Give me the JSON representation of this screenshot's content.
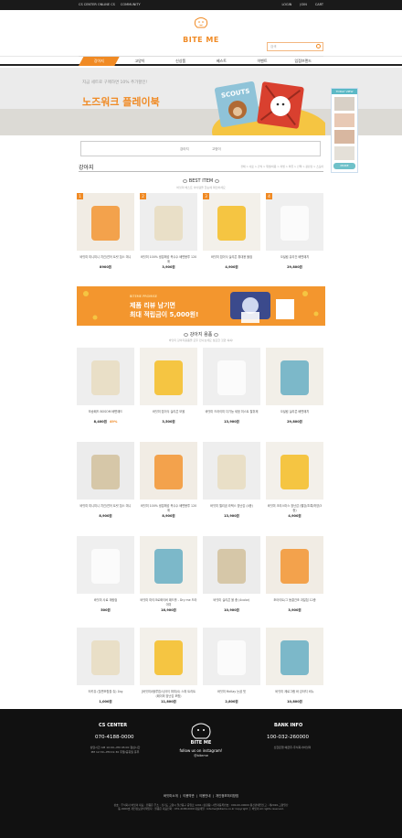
{
  "topbar": {
    "left": [
      "CS CENTER ONLINE CS",
      "COMMUNITY"
    ],
    "right": [
      "LOGIN",
      "JOIN",
      "CART"
    ]
  },
  "logo": {
    "text": "BITE ME"
  },
  "search": {
    "placeholder": "검색"
  },
  "nav": [
    "강아지",
    "고양이",
    "신상품",
    "베스트",
    "이벤트",
    "입점브랜드"
  ],
  "banner": {
    "small": "지금 세트로 구매하면 10% 추가할인!",
    "title": "노즈워크 플레이북",
    "art_labels": [
      "SCOUTS"
    ]
  },
  "sidebar": {
    "header": "TODAY VIEW",
    "footer": "MORE"
  },
  "category": {
    "items": [
      "강아지",
      "고양이"
    ]
  },
  "page": {
    "title": "강아지",
    "breadcrumb": "전체 > 사료 > 간식 > 위생/미용 > 리빙 > 의류 > 산책 > 장난감 > 스토어"
  },
  "best": {
    "title": "BEST ITEM",
    "subtitle": "바잇미 베스트 아이템을 한눈에 확인하세요",
    "items": [
      {
        "rank": "1",
        "name": "바잇미 미니미니 치킨/연어 트릿 칩스 미니",
        "price": "8900원"
      },
      {
        "rank": "2",
        "name": "바잇미 100% 생분해성 옥수수 배변봉투 120매",
        "price": "3,900원"
      },
      {
        "rank": "3",
        "name": "바잇미 접이식 실리콘 휴대용 물컵",
        "price": "4,900원"
      },
      {
        "rank": "4",
        "name": "오설림 유리건 배변패치",
        "price": "29,800원"
      }
    ]
  },
  "promo": {
    "tag": "BITEME PROMISE",
    "line1": "제품 리뷰 남기면",
    "line2": "최대 적립금이 5,000원!"
  },
  "dog": {
    "title": "강아지 용품",
    "subtitle": "바잇미 강아지용품을 모두 만나보세요 필요한 것만 쏙쏙!",
    "rows": [
      [
        {
          "name": "보송패드 BOSOM 배변패드",
          "price": "8,400원",
          "sale": "49%"
        },
        {
          "name": "바잇미 접이식 실리콘 보울",
          "price": "3,500원"
        },
        {
          "name": "바잇미 드라이미 다기능 세정 미스트 탈취제",
          "price": "13,900원"
        },
        {
          "name": "오설림 실리콘 배변패치",
          "price": "29,800원"
        }
      ],
      [
        {
          "name": "바잇미 미니미니 치킨/연어 트릿 칩스 미니",
          "price": "8,900원"
        },
        {
          "name": "바잇미 100% 생분해성 옥수수 배변봉투 120매",
          "price": "8,900원"
        },
        {
          "name": "바잇미 젤리곰 라텍스 장난감 (4종)",
          "price": "13,900원"
        },
        {
          "name": "바잇미 크리스마스 장난감 (빨강/초록/하양/3종)",
          "price": "4,900원"
        }
      ],
      [
        {
          "name": "바잇미 사료 계량컵",
          "price": "500원"
        },
        {
          "name": "바잇미 마이크로화이버 패드롤 - Dry me 드라이미",
          "price": "16,900원"
        },
        {
          "name": "바잇미 실리콘 볼 중 (4color)",
          "price": "10,900원"
        },
        {
          "name": "조아이트/그 동결건조 과일칩 12종",
          "price": "3,900원"
        }
      ],
      [
        {
          "name": "터키츄 (칠면조힘줄 츄) 1kg",
          "price": "1,000원"
        },
        {
          "name": "[바잇미X블루칩스]아이 퍼피(S) 스파 트리트 (페이퍼 장난감 포함)",
          "price": "11,800원"
        },
        {
          "name": "바잇미 McKay 눈곱 빗",
          "price": "2,800원"
        },
        {
          "name": "바잇미 제로그램 바 강아지 비누",
          "price": "10,800원"
        }
      ]
    ]
  },
  "footer": {
    "cs_title": "CS CENTER",
    "cs_phone": "070-4188-0000",
    "cs_hours": "상담시간 AM 10:00~PM 05:00 점심시간 PM 12:30~PM 01:30 주말/공휴일 휴무",
    "insta": "follow us on instagram!",
    "insta_id": "@biteme",
    "bank_title": "BANK INFO",
    "bank_phone": "100-032-260000",
    "bank_owner": "신한은행 예금주-주식회사바잇미",
    "links": [
      "바잇미소개",
      "이용약관",
      "이용안내",
      "개인정보처리방침"
    ],
    "address": "상호 : 주식회사 바잇미 대표 : 원종은 주소 : 경기도 고양시 일산동구 중앙로 1261 (장항동) 사업자등록번호 : 000-00-00000 통신판매업신고 : 제2020-고양일산동-0000호 개인정보관리책임자 : 원종은 대표전화 : 070-4188-0000 대표메일 : biteme@biteme.co.kr Copyright ⓒ 바잇미 All rights reserved."
  },
  "colors": {
    "accent": "#f08a24",
    "dark": "#111111",
    "teal": "#5bb9c6"
  }
}
